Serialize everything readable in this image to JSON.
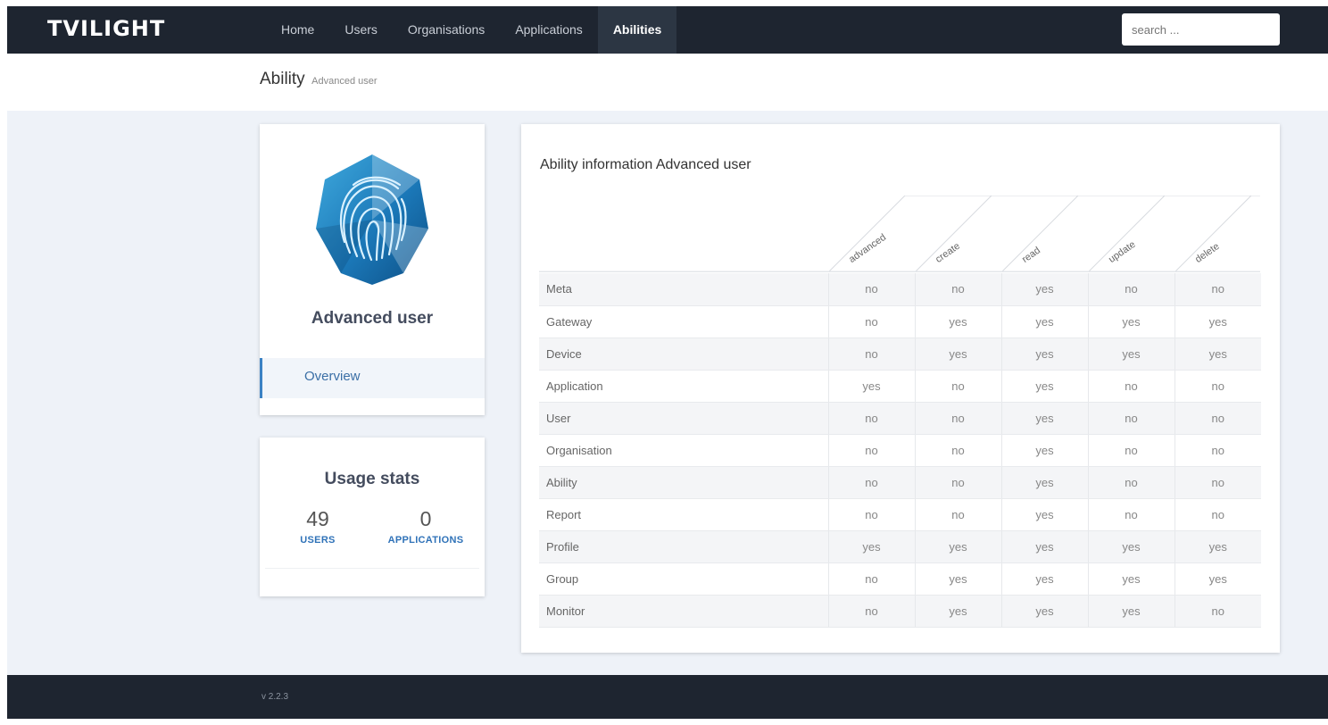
{
  "brand": "TVILIGHT",
  "nav": {
    "items": [
      {
        "label": "Home",
        "active": false
      },
      {
        "label": "Users",
        "active": false
      },
      {
        "label": "Organisations",
        "active": false
      },
      {
        "label": "Applications",
        "active": false
      },
      {
        "label": "Abilities",
        "active": true
      }
    ],
    "search_placeholder": "search ..."
  },
  "page_heading": {
    "title": "Ability",
    "subtitle": "Advanced user"
  },
  "profile": {
    "avatar_icon": "fingerprint-hexagon-icon",
    "name": "Advanced user",
    "menu_overview": "Overview"
  },
  "stats": {
    "title": "Usage stats",
    "users_count": "49",
    "users_label": "USERS",
    "applications_count": "0",
    "applications_label": "APPLICATIONS"
  },
  "ability_info": {
    "title": "Ability information Advanced user",
    "columns": [
      "advanced",
      "create",
      "read",
      "update",
      "delete"
    ],
    "rows": [
      {
        "name": "Meta",
        "values": [
          "no",
          "no",
          "yes",
          "no",
          "no"
        ]
      },
      {
        "name": "Gateway",
        "values": [
          "no",
          "yes",
          "yes",
          "yes",
          "yes"
        ]
      },
      {
        "name": "Device",
        "values": [
          "no",
          "yes",
          "yes",
          "yes",
          "yes"
        ]
      },
      {
        "name": "Application",
        "values": [
          "yes",
          "no",
          "yes",
          "no",
          "no"
        ]
      },
      {
        "name": "User",
        "values": [
          "no",
          "no",
          "yes",
          "no",
          "no"
        ]
      },
      {
        "name": "Organisation",
        "values": [
          "no",
          "no",
          "yes",
          "no",
          "no"
        ]
      },
      {
        "name": "Ability",
        "values": [
          "no",
          "no",
          "yes",
          "no",
          "no"
        ]
      },
      {
        "name": "Report",
        "values": [
          "no",
          "no",
          "yes",
          "no",
          "no"
        ]
      },
      {
        "name": "Profile",
        "values": [
          "yes",
          "yes",
          "yes",
          "yes",
          "yes"
        ]
      },
      {
        "name": "Group",
        "values": [
          "no",
          "yes",
          "yes",
          "yes",
          "yes"
        ]
      },
      {
        "name": "Monitor",
        "values": [
          "no",
          "yes",
          "yes",
          "yes",
          "no"
        ]
      }
    ]
  },
  "footer": {
    "version": "v 2.2.3"
  },
  "colors": {
    "navbar": "#1e2530",
    "nav_active": "#2c3643",
    "accent": "#2f72b8",
    "content_bg": "#eef2f8"
  }
}
